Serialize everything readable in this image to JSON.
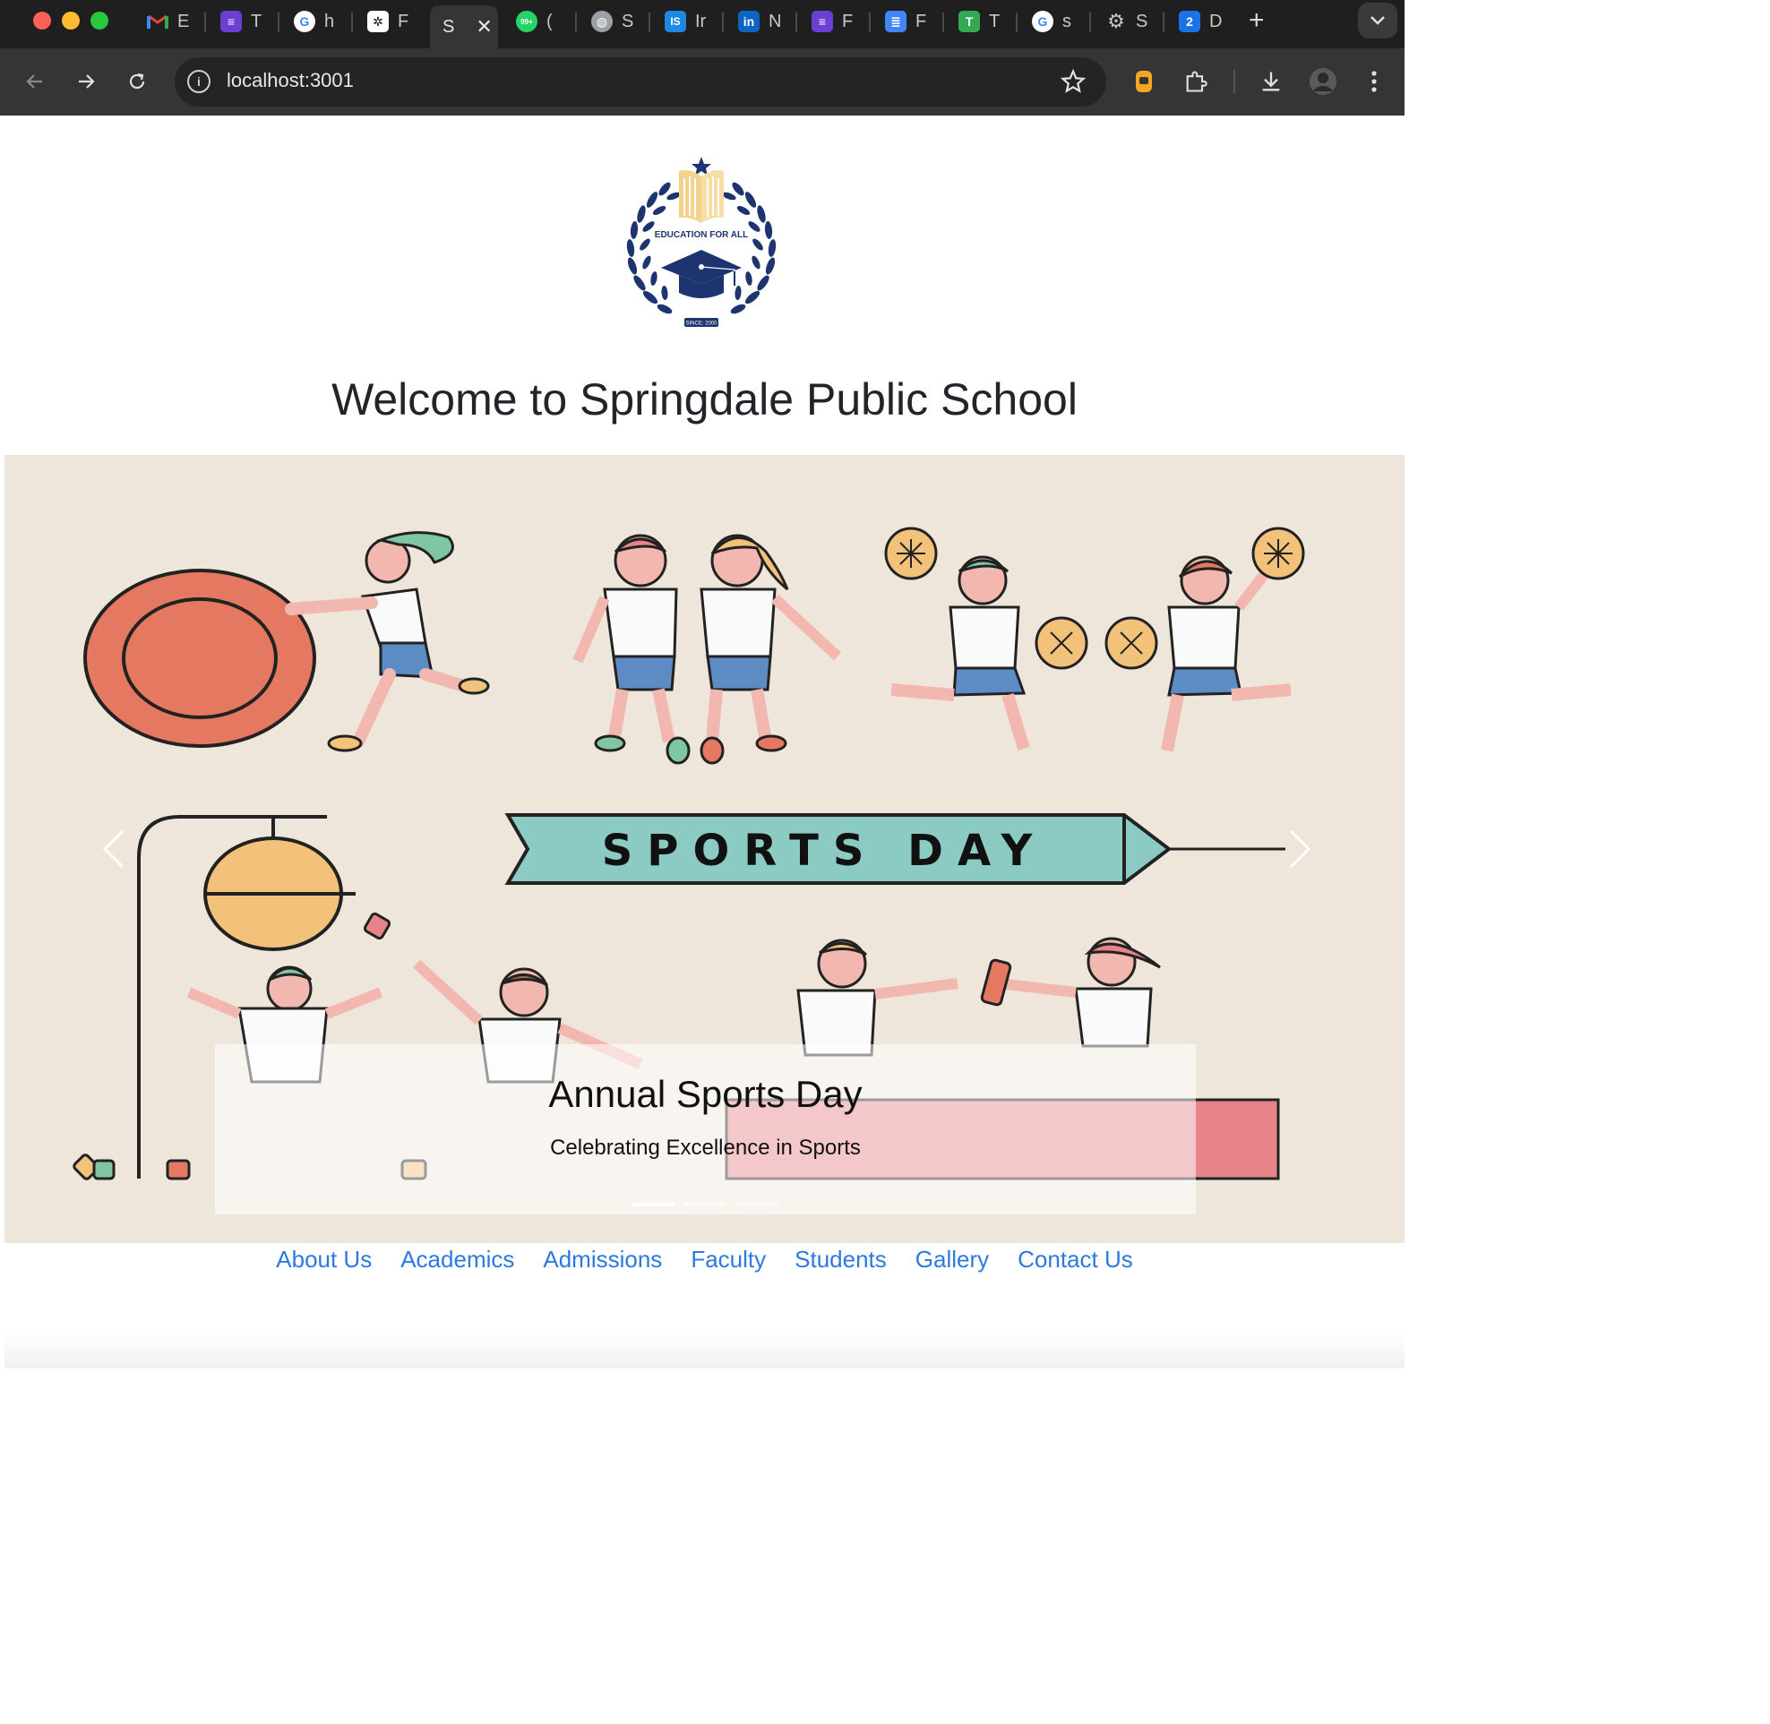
{
  "browser": {
    "tabs": [
      {
        "icon": "gmail-icon",
        "title": "E",
        "color": "#ea4335"
      },
      {
        "icon": "list-doc-icon",
        "title": "T",
        "color": "#6b3fd1"
      },
      {
        "icon": "google-icon",
        "title": "h",
        "color": "#4285f4"
      },
      {
        "icon": "openai-icon",
        "title": "F",
        "color": "#ffffff"
      },
      {
        "icon": "page-icon",
        "title": "S",
        "color": "#cccccc",
        "active": true
      },
      {
        "icon": "whatsapp-icon",
        "title": "(",
        "color": "#25d366",
        "badge": "99+"
      },
      {
        "icon": "globe-icon",
        "title": "S",
        "color": "#9aa0a6"
      },
      {
        "icon": "is-icon",
        "title": "Ir",
        "color": "#1e88e5",
        "glyph": "IS"
      },
      {
        "icon": "linkedin-icon",
        "title": "N",
        "color": "#0a66c2",
        "glyph": "in"
      },
      {
        "icon": "list-doc-icon",
        "title": "F",
        "color": "#6b3fd1"
      },
      {
        "icon": "docs-icon",
        "title": "F",
        "color": "#4285f4"
      },
      {
        "icon": "t-icon",
        "title": "T",
        "color": "#34a853",
        "glyph": "T"
      },
      {
        "icon": "google-icon",
        "title": "s",
        "color": "#4285f4"
      },
      {
        "icon": "settings-icon",
        "title": "S",
        "color": "#9aa0a6"
      },
      {
        "icon": "two-icon",
        "title": "D",
        "color": "#1a73e8",
        "glyph": "2"
      }
    ],
    "url": "localhost:3001"
  },
  "logo": {
    "top_text": "EDUCATION FOR ALL",
    "since_text": "SINCE: 2000"
  },
  "page_title": "Welcome to Springdale Public School",
  "carousel": {
    "banner_text": "SPORTS DAY",
    "caption_title": "Annual Sports Day",
    "caption_subtitle": "Celebrating Excellence in Sports",
    "slide_count": 3,
    "active_slide": 1
  },
  "nav": {
    "items": [
      "About Us",
      "Academics",
      "Admissions",
      "Faculty",
      "Students",
      "Gallery",
      "Contact Us"
    ]
  }
}
